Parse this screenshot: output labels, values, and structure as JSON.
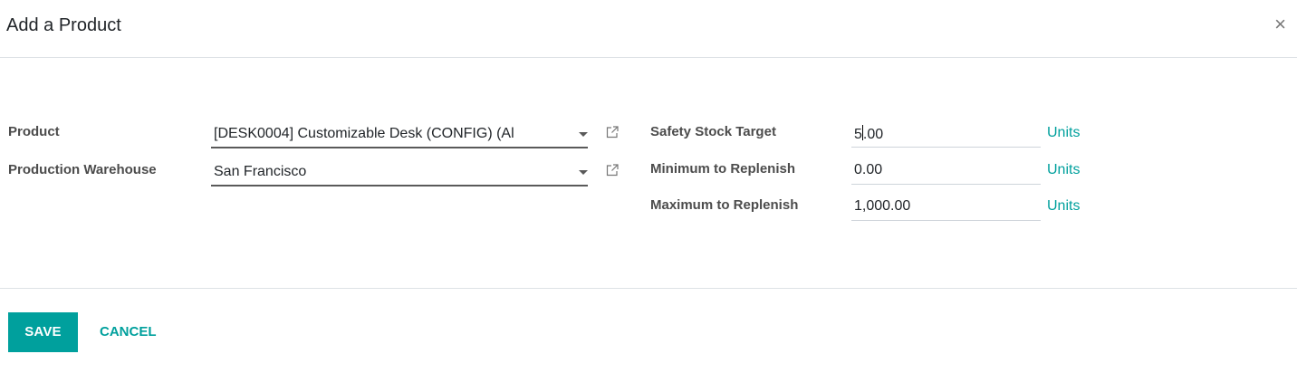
{
  "dialog": {
    "title": "Add a Product",
    "close_label": "×"
  },
  "form": {
    "product_label": "Product",
    "product_value": "[DESK0004] Customizable Desk (CONFIG) (Al",
    "warehouse_label": "Production Warehouse",
    "warehouse_value": "San Francisco",
    "safety_label": "Safety Stock Target",
    "safety_value_before_cursor": "5",
    "safety_value_after_cursor": ".00",
    "safety_unit": "Units",
    "min_label": "Minimum to Replenish",
    "min_value": "0.00",
    "min_unit": "Units",
    "max_label": "Maximum to Replenish",
    "max_value": "1,000.00",
    "max_unit": "Units"
  },
  "footer": {
    "save_label": "SAVE",
    "cancel_label": "CANCEL"
  },
  "colors": {
    "accent": "#00a09d",
    "label": "#4c4c4c",
    "border": "#dee2e6"
  },
  "icons": {
    "external_link": "external-link-icon",
    "dropdown": "caret-down-icon",
    "close": "close-icon"
  }
}
